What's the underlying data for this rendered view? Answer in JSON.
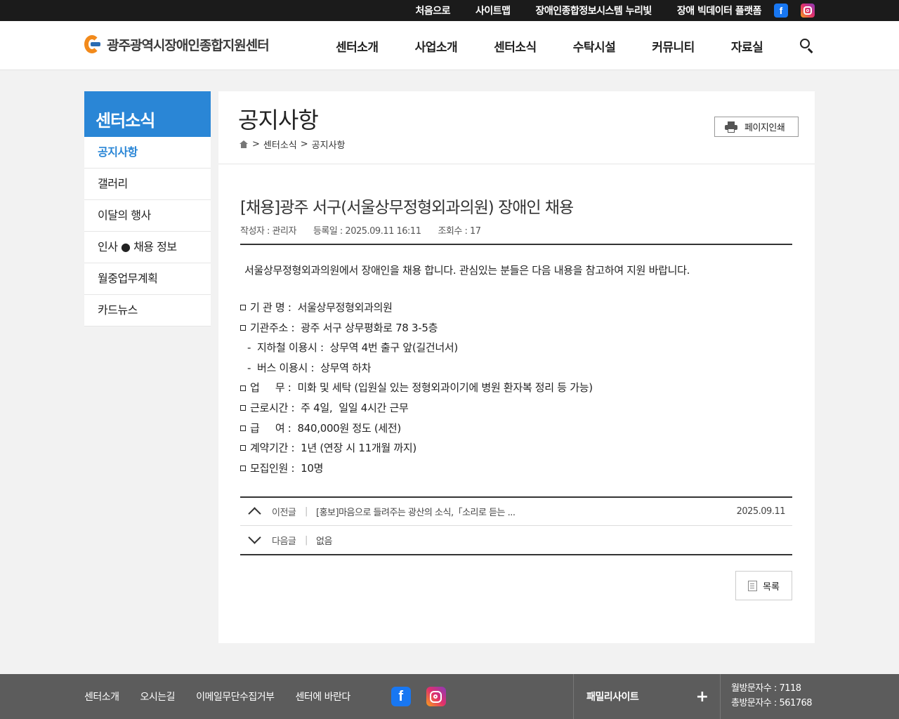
{
  "topbar": {
    "links": [
      "처음으로",
      "사이트맵",
      "장애인종합정보시스템 누리빛",
      "장애 빅데이터 플랫폼"
    ],
    "sns": [
      "facebook-icon",
      "instagram-icon"
    ]
  },
  "header": {
    "logo_text": "광주광역시장애인종합지원센터",
    "nav": [
      "센터소개",
      "사업소개",
      "센터소식",
      "수탁시설",
      "커뮤니티",
      "자료실"
    ]
  },
  "sidebar": {
    "title": "센터소식",
    "items": [
      "공지사항",
      "갤러리",
      "이달의 행사",
      "인사 ● 채용 정보",
      "월중업무계획",
      "카드뉴스"
    ],
    "active_index": 0
  },
  "page": {
    "title": "공지사항",
    "breadcrumb": [
      ">",
      "센터소식",
      ">",
      "공지사항"
    ],
    "print_label": "페이지인쇄"
  },
  "post": {
    "title": "[채용]광주 서구(서울상무정형외과의원) 장애인 채용",
    "author": "작성자 : 관리자",
    "date": "등록일 : 2025.09.11 16:11",
    "views": "조회수 : 17",
    "lead": "서울상무정형외과의원에서 장애인을 채용 합니다. 관심있는 분들은 다음 내용을 참고하여 지원 바랍니다.",
    "lines": [
      {
        "type": "item",
        "text": "기 관 명 :  서울상무정형외과의원"
      },
      {
        "type": "item",
        "text": "기관주소 :  광주 서구 상무평화로 78 3-5층"
      },
      {
        "type": "sub",
        "text": "-  지하철 이용시 :  상무역 4번 출구 앞(길건너서)"
      },
      {
        "type": "sub",
        "text": "-  버스 이용시 :  상무역 하차"
      },
      {
        "type": "item",
        "text": "업     무 :  미화 및 세탁 (입원실 있는 정형외과이기에 병원 환자복 정리 등 가능)"
      },
      {
        "type": "item",
        "text": "근로시간 :  주 4일,  일일 4시간 근무"
      },
      {
        "type": "item",
        "text": "급     여 :  840,000원 정도 (세전)"
      },
      {
        "type": "item",
        "text": "계약기간 :  1년 (연장 시 11개월 까지)"
      },
      {
        "type": "item",
        "text": "모집인원 :  10명"
      }
    ]
  },
  "postnav": {
    "prev_label": "이전글",
    "prev_title": "[홍보]마음으로 들려주는 광산의 소식,「소리로 듣는 ...",
    "prev_date": "2025.09.11",
    "next_label": "다음글",
    "next_title": "없음"
  },
  "list_button": "목록",
  "footer": {
    "links": [
      "센터소개",
      "오시는길",
      "이메일무단수집거부",
      "센터에 바란다"
    ],
    "family_label": "패밀리사이트",
    "monthly": "월방문자수 : 7118",
    "total": "총방문자수 : 561768"
  }
}
